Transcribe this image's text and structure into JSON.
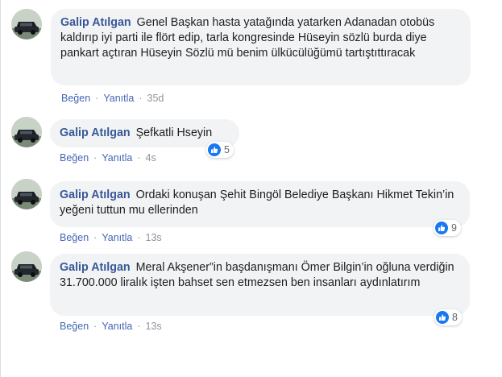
{
  "comments": [
    {
      "author": "Galip Atılgan",
      "text": "Genel Başkan hasta yatağında yatarken Adanadan otobüs kaldırıp iyi parti ile flört edip, tarla kongresinde Hüseyin sözlü burda diye pankart açtıran Hüseyin Sözlü mü benim ülkücülüğümü tartıştıttıracak",
      "like_label": "Beğen",
      "reply_label": "Yanıtla",
      "time": "35d"
    },
    {
      "author": "Galip Atılgan",
      "text": "Şefkatli Hseyin",
      "like_label": "Beğen",
      "reply_label": "Yanıtla",
      "time": "4s",
      "reaction_count": "5"
    },
    {
      "author": "Galip Atılgan",
      "text": "Ordaki konuşan Şehit Bingöl Belediye Başkanı Hikmet Tekin’in yeğeni tuttun mu ellerinden",
      "like_label": "Beğen",
      "reply_label": "Yanıtla",
      "time": "13s",
      "reaction_count": "9"
    },
    {
      "author": "Galip Atılgan",
      "text": "Meral Akşener”in başdanışmanı Ömer Bilgin’in oğluna verdiğin 31.700.000 liralık işten bahset sen etmezsen ben insanları aydınlatırım",
      "like_label": "Beğen",
      "reply_label": "Yanıtla",
      "time": "13s",
      "reaction_count": "8"
    }
  ],
  "colors": {
    "author": "#385898",
    "action": "#4267b2",
    "bubble": "#f2f3f5",
    "meta": "#90949c",
    "like_badge": "#1877f2"
  },
  "icons": {
    "avatar": "profile-photo-car",
    "reaction": "thumbs-up-icon"
  }
}
